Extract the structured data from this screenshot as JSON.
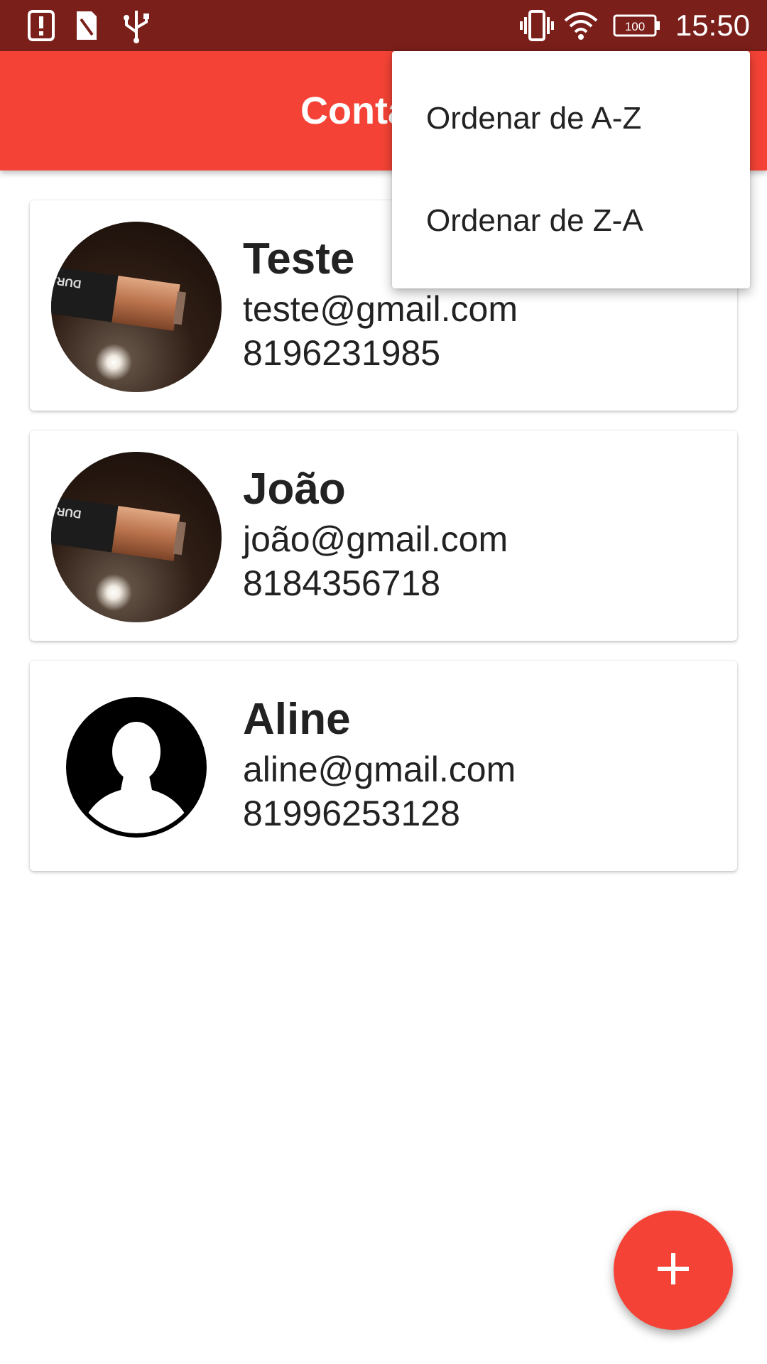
{
  "status_bar": {
    "time": "15:50",
    "battery_level": "100",
    "icons": [
      "alert-icon",
      "sim-card-icon",
      "usb-icon",
      "vibrate-icon",
      "wifi-icon",
      "battery-icon"
    ]
  },
  "app_bar": {
    "title": "Contatos"
  },
  "menu": {
    "items": [
      {
        "label": "Ordenar de A-Z"
      },
      {
        "label": "Ordenar de Z-A"
      }
    ]
  },
  "contacts": [
    {
      "name": "Teste",
      "email": "teste@gmail.com",
      "phone": "8196231985",
      "avatar": "photo-battery"
    },
    {
      "name": "João",
      "email": "joão@gmail.com",
      "phone": "8184356718",
      "avatar": "photo-battery"
    },
    {
      "name": "Aline",
      "email": "aline@gmail.com",
      "phone": "81996253128",
      "avatar": "default-person-icon"
    }
  ],
  "fab": {
    "icon": "plus-icon"
  },
  "colors": {
    "status_bar": "#7a1f1a",
    "primary": "#f44336",
    "text": "#222222"
  }
}
